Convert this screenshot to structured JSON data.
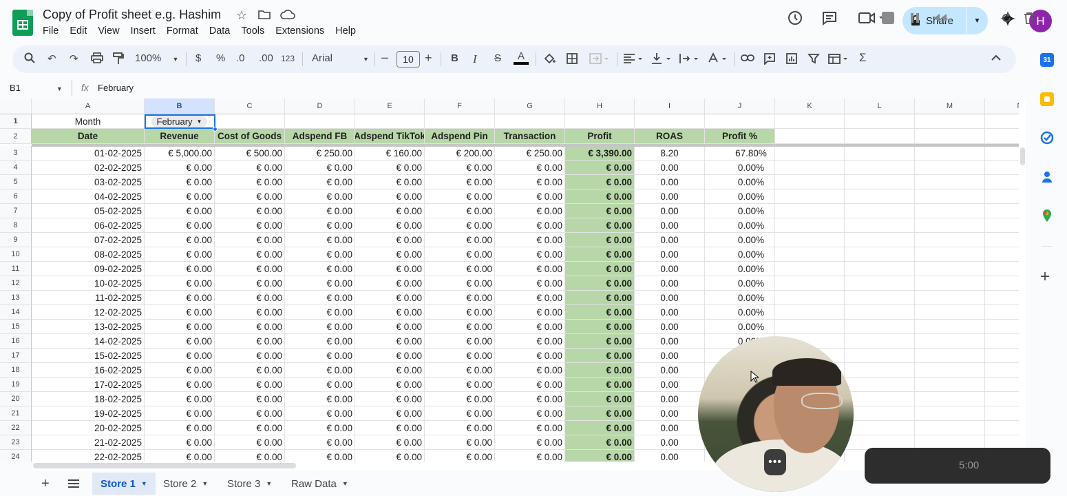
{
  "app": {
    "title": "Copy of Profit sheet e.g. Hashim",
    "menu": [
      "File",
      "Edit",
      "View",
      "Insert",
      "Format",
      "Data",
      "Tools",
      "Extensions",
      "Help"
    ],
    "share_label": "Share",
    "avatar_letter": "H"
  },
  "toolbar": {
    "zoom": "100%",
    "currency": "$",
    "percent": "%",
    "dec_less": ".0",
    "dec_more": ".00",
    "number_format": "123",
    "font": "Arial",
    "font_size": "10",
    "bold": "B",
    "italic": "I",
    "strike": "S",
    "text_color": "A"
  },
  "formula_bar": {
    "name_box": "B1",
    "fx": "fx",
    "value": "February"
  },
  "columns": [
    "A",
    "B",
    "C",
    "D",
    "E",
    "F",
    "G",
    "H",
    "I",
    "J",
    "K",
    "L",
    "M",
    "N"
  ],
  "row1": {
    "label": "Month",
    "month": "February"
  },
  "headers": [
    "Date",
    "Revenue",
    "Cost of Goods",
    "Adspend FB",
    "Adspend TikTok",
    "Adspend Pin",
    "Transaction",
    "Profit",
    "ROAS",
    "Profit %"
  ],
  "rows": [
    {
      "row": "3",
      "cells": [
        "01-02-2025",
        "€ 5,000.00",
        "€ 500.00",
        "€ 250.00",
        "€ 160.00",
        "€ 200.00",
        "€ 250.00",
        "€ 3,390.00",
        "8.20",
        "67.80%"
      ]
    },
    {
      "row": "4",
      "cells": [
        "02-02-2025",
        "€ 0.00",
        "€ 0.00",
        "€ 0.00",
        "€ 0.00",
        "€ 0.00",
        "€ 0.00",
        "€ 0.00",
        "0.00",
        "0.00%"
      ]
    },
    {
      "row": "5",
      "cells": [
        "03-02-2025",
        "€ 0.00",
        "€ 0.00",
        "€ 0.00",
        "€ 0.00",
        "€ 0.00",
        "€ 0.00",
        "€ 0.00",
        "0.00",
        "0.00%"
      ]
    },
    {
      "row": "6",
      "cells": [
        "04-02-2025",
        "€ 0.00",
        "€ 0.00",
        "€ 0.00",
        "€ 0.00",
        "€ 0.00",
        "€ 0.00",
        "€ 0.00",
        "0.00",
        "0.00%"
      ]
    },
    {
      "row": "7",
      "cells": [
        "05-02-2025",
        "€ 0.00",
        "€ 0.00",
        "€ 0.00",
        "€ 0.00",
        "€ 0.00",
        "€ 0.00",
        "€ 0.00",
        "0.00",
        "0.00%"
      ]
    },
    {
      "row": "8",
      "cells": [
        "06-02-2025",
        "€ 0.00",
        "€ 0.00",
        "€ 0.00",
        "€ 0.00",
        "€ 0.00",
        "€ 0.00",
        "€ 0.00",
        "0.00",
        "0.00%"
      ]
    },
    {
      "row": "9",
      "cells": [
        "07-02-2025",
        "€ 0.00",
        "€ 0.00",
        "€ 0.00",
        "€ 0.00",
        "€ 0.00",
        "€ 0.00",
        "€ 0.00",
        "0.00",
        "0.00%"
      ]
    },
    {
      "row": "10",
      "cells": [
        "08-02-2025",
        "€ 0.00",
        "€ 0.00",
        "€ 0.00",
        "€ 0.00",
        "€ 0.00",
        "€ 0.00",
        "€ 0.00",
        "0.00",
        "0.00%"
      ]
    },
    {
      "row": "11",
      "cells": [
        "09-02-2025",
        "€ 0.00",
        "€ 0.00",
        "€ 0.00",
        "€ 0.00",
        "€ 0.00",
        "€ 0.00",
        "€ 0.00",
        "0.00",
        "0.00%"
      ]
    },
    {
      "row": "12",
      "cells": [
        "10-02-2025",
        "€ 0.00",
        "€ 0.00",
        "€ 0.00",
        "€ 0.00",
        "€ 0.00",
        "€ 0.00",
        "€ 0.00",
        "0.00",
        "0.00%"
      ]
    },
    {
      "row": "13",
      "cells": [
        "11-02-2025",
        "€ 0.00",
        "€ 0.00",
        "€ 0.00",
        "€ 0.00",
        "€ 0.00",
        "€ 0.00",
        "€ 0.00",
        "0.00",
        "0.00%"
      ]
    },
    {
      "row": "14",
      "cells": [
        "12-02-2025",
        "€ 0.00",
        "€ 0.00",
        "€ 0.00",
        "€ 0.00",
        "€ 0.00",
        "€ 0.00",
        "€ 0.00",
        "0.00",
        "0.00%"
      ]
    },
    {
      "row": "15",
      "cells": [
        "13-02-2025",
        "€ 0.00",
        "€ 0.00",
        "€ 0.00",
        "€ 0.00",
        "€ 0.00",
        "€ 0.00",
        "€ 0.00",
        "0.00",
        "0.00%"
      ]
    },
    {
      "row": "16",
      "cells": [
        "14-02-2025",
        "€ 0.00",
        "€ 0.00",
        "€ 0.00",
        "€ 0.00",
        "€ 0.00",
        "€ 0.00",
        "€ 0.00",
        "0.00",
        "0.00%"
      ]
    },
    {
      "row": "17",
      "cells": [
        "15-02-2025",
        "€ 0.00",
        "€ 0.00",
        "€ 0.00",
        "€ 0.00",
        "€ 0.00",
        "€ 0.00",
        "€ 0.00",
        "0.00",
        ""
      ]
    },
    {
      "row": "18",
      "cells": [
        "16-02-2025",
        "€ 0.00",
        "€ 0.00",
        "€ 0.00",
        "€ 0.00",
        "€ 0.00",
        "€ 0.00",
        "€ 0.00",
        "0.00",
        ""
      ]
    },
    {
      "row": "19",
      "cells": [
        "17-02-2025",
        "€ 0.00",
        "€ 0.00",
        "€ 0.00",
        "€ 0.00",
        "€ 0.00",
        "€ 0.00",
        "€ 0.00",
        "0.00",
        ""
      ]
    },
    {
      "row": "20",
      "cells": [
        "18-02-2025",
        "€ 0.00",
        "€ 0.00",
        "€ 0.00",
        "€ 0.00",
        "€ 0.00",
        "€ 0.00",
        "€ 0.00",
        "0.00",
        ""
      ]
    },
    {
      "row": "21",
      "cells": [
        "19-02-2025",
        "€ 0.00",
        "€ 0.00",
        "€ 0.00",
        "€ 0.00",
        "€ 0.00",
        "€ 0.00",
        "€ 0.00",
        "0.00",
        ""
      ]
    },
    {
      "row": "22",
      "cells": [
        "20-02-2025",
        "€ 0.00",
        "€ 0.00",
        "€ 0.00",
        "€ 0.00",
        "€ 0.00",
        "€ 0.00",
        "€ 0.00",
        "0.00",
        ""
      ]
    },
    {
      "row": "23",
      "cells": [
        "21-02-2025",
        "€ 0.00",
        "€ 0.00",
        "€ 0.00",
        "€ 0.00",
        "€ 0.00",
        "€ 0.00",
        "€ 0.00",
        "0.00",
        ""
      ]
    },
    {
      "row": "24",
      "cells": [
        "22-02-2025",
        "€ 0.00",
        "€ 0.00",
        "€ 0.00",
        "€ 0.00",
        "€ 0.00",
        "€ 0.00",
        "€ 0.00",
        "0.00",
        ""
      ]
    }
  ],
  "sheets": [
    {
      "label": "Store 1",
      "active": true
    },
    {
      "label": "Store 2",
      "active": false
    },
    {
      "label": "Store 3",
      "active": false
    },
    {
      "label": "Raw Data",
      "active": false
    }
  ],
  "recorder": {
    "time": "5:00"
  },
  "colors": {
    "header_green": "#b7d7a8",
    "selection_blue": "#1a73e8",
    "share_bg": "#c2e7ff",
    "avatar_bg": "#8e24aa"
  }
}
